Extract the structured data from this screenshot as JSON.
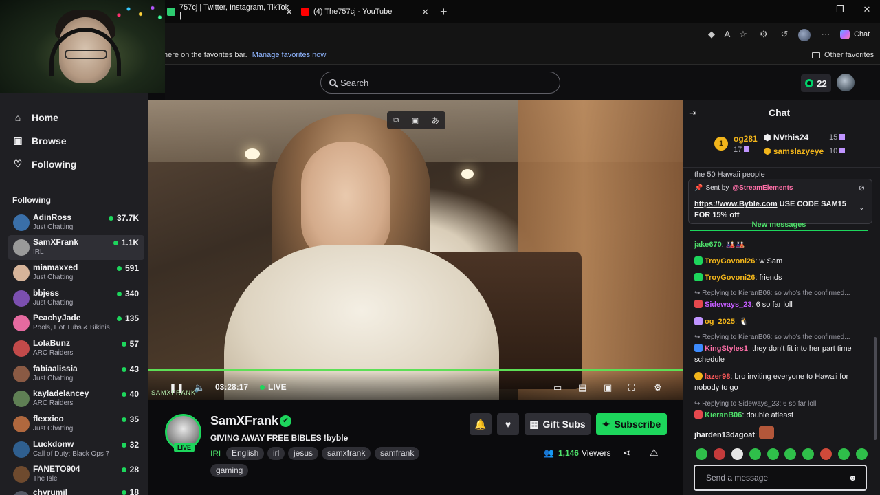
{
  "browser": {
    "tabs": [
      {
        "title": "757cj | Twitter, Instagram, TikTok |",
        "color": "#2ecc71"
      },
      {
        "title": "(4) The757cj - YouTube",
        "color": "#ff0000"
      }
    ],
    "favorites_bar": {
      "message": "here on the favorites bar.",
      "manage_link": "Manage favorites now",
      "other_favorites": "Other favorites"
    },
    "copilot_label": "Chat"
  },
  "top": {
    "search_placeholder": "Search",
    "points": "22"
  },
  "sidebar": {
    "nav": [
      {
        "label": "Home",
        "icon": "home-icon"
      },
      {
        "label": "Browse",
        "icon": "browse-icon"
      },
      {
        "label": "Following",
        "icon": "heart-icon"
      }
    ],
    "following_heading": "Following",
    "channels": [
      {
        "name": "AdinRoss",
        "category": "Just Chatting",
        "viewers": "37.7K",
        "avatar": "#3a6fa8"
      },
      {
        "name": "SamXFrank",
        "category": "IRL",
        "viewers": "1.1K",
        "avatar": "#9a9a9a"
      },
      {
        "name": "miamaxxed",
        "category": "Just Chatting",
        "viewers": "591",
        "avatar": "#d6b49a"
      },
      {
        "name": "bbjess",
        "category": "Just Chatting",
        "viewers": "340",
        "avatar": "#7b4fb0"
      },
      {
        "name": "PeachyJade",
        "category": "Pools, Hot Tubs & Bikinis",
        "viewers": "135",
        "avatar": "#e56aa0"
      },
      {
        "name": "LolaBunz",
        "category": "ARC Raiders",
        "viewers": "57",
        "avatar": "#c24a4a"
      },
      {
        "name": "fabiaalissia",
        "category": "Just Chatting",
        "viewers": "43",
        "avatar": "#8a5a44"
      },
      {
        "name": "kayladelancey",
        "category": "ARC Raiders",
        "viewers": "40",
        "avatar": "#5f7f54"
      },
      {
        "name": "flexxico",
        "category": "Just Chatting",
        "viewers": "35",
        "avatar": "#b0683e"
      },
      {
        "name": "Luckdonw",
        "category": "Call of Duty: Black Ops 7",
        "viewers": "32",
        "avatar": "#2f5f8f"
      },
      {
        "name": "FANETO904",
        "category": "The Isle",
        "viewers": "28",
        "avatar": "#6e4a2e"
      },
      {
        "name": "chyrumil",
        "category": "",
        "viewers": "18",
        "avatar": "#555a66"
      }
    ]
  },
  "player": {
    "time": "03:28:17",
    "live_label": "LIVE",
    "overlay_text": "SAMXFRANK"
  },
  "stream": {
    "channel": "SamXFrank",
    "live_badge": "LIVE",
    "title": "GIVING AWAY FREE BIBLES !byble",
    "category": "IRL",
    "tags": [
      "English",
      "irl",
      "jesus",
      "samxfrank",
      "samfrank",
      "gaming"
    ],
    "gift_label": "Gift Subs",
    "subscribe_label": "Subscribe",
    "viewer_count": "1,146",
    "viewers_label": "Viewers"
  },
  "chat": {
    "title": "Chat",
    "leaderboard": [
      {
        "rank": "1",
        "name": "og281",
        "count": "17",
        "color": "#f2b51b"
      },
      {
        "name": "NVthis24",
        "count": "15",
        "color": "#efeff1"
      },
      {
        "name": "samslazyeye",
        "count": "10",
        "color": "#f2b51b"
      }
    ],
    "peek_message": "the 50 Hawaii people",
    "pinned": {
      "sent_by": "Sent by",
      "author": "@StreamElements",
      "link": "https://www.Byble.com",
      "text": " USE CODE SAM15 FOR 15% off"
    },
    "new_messages": "New messages",
    "messages": [
      {
        "user": "jake670",
        "color": "#4ee06a",
        "text": "🎎🎎"
      },
      {
        "user": "TroyGovoni26",
        "color": "#f2b51b",
        "text": "w Sam"
      },
      {
        "user": "TroyGovoni26",
        "color": "#f2b51b",
        "text": "friends"
      },
      {
        "reply": "Replying to KieranB06: so who's the confirmed...",
        "user": "Sideways_23",
        "color": "#c45cff",
        "text": "6 so far loll"
      },
      {
        "user": "og_2025",
        "color": "#f2b51b",
        "text": "🐧"
      },
      {
        "reply": "Replying to KieranB06: so who's the confirmed...",
        "user": "KingStyles1",
        "color": "#ff6fa8",
        "text": "they don't fit into her part time schedule"
      },
      {
        "user": "lazer98",
        "color": "#ff5a5a",
        "text": "bro inviting everyone to Hawaii for nobody to go"
      },
      {
        "reply": "Replying to Sideways_23: 6 so far loll",
        "user": "KieranB06",
        "color": "#4ee06a",
        "text": "double atleast"
      },
      {
        "user": "jharden13dagoat",
        "color": "#efeff1",
        "text": ""
      }
    ],
    "input_placeholder": "Send a message"
  }
}
